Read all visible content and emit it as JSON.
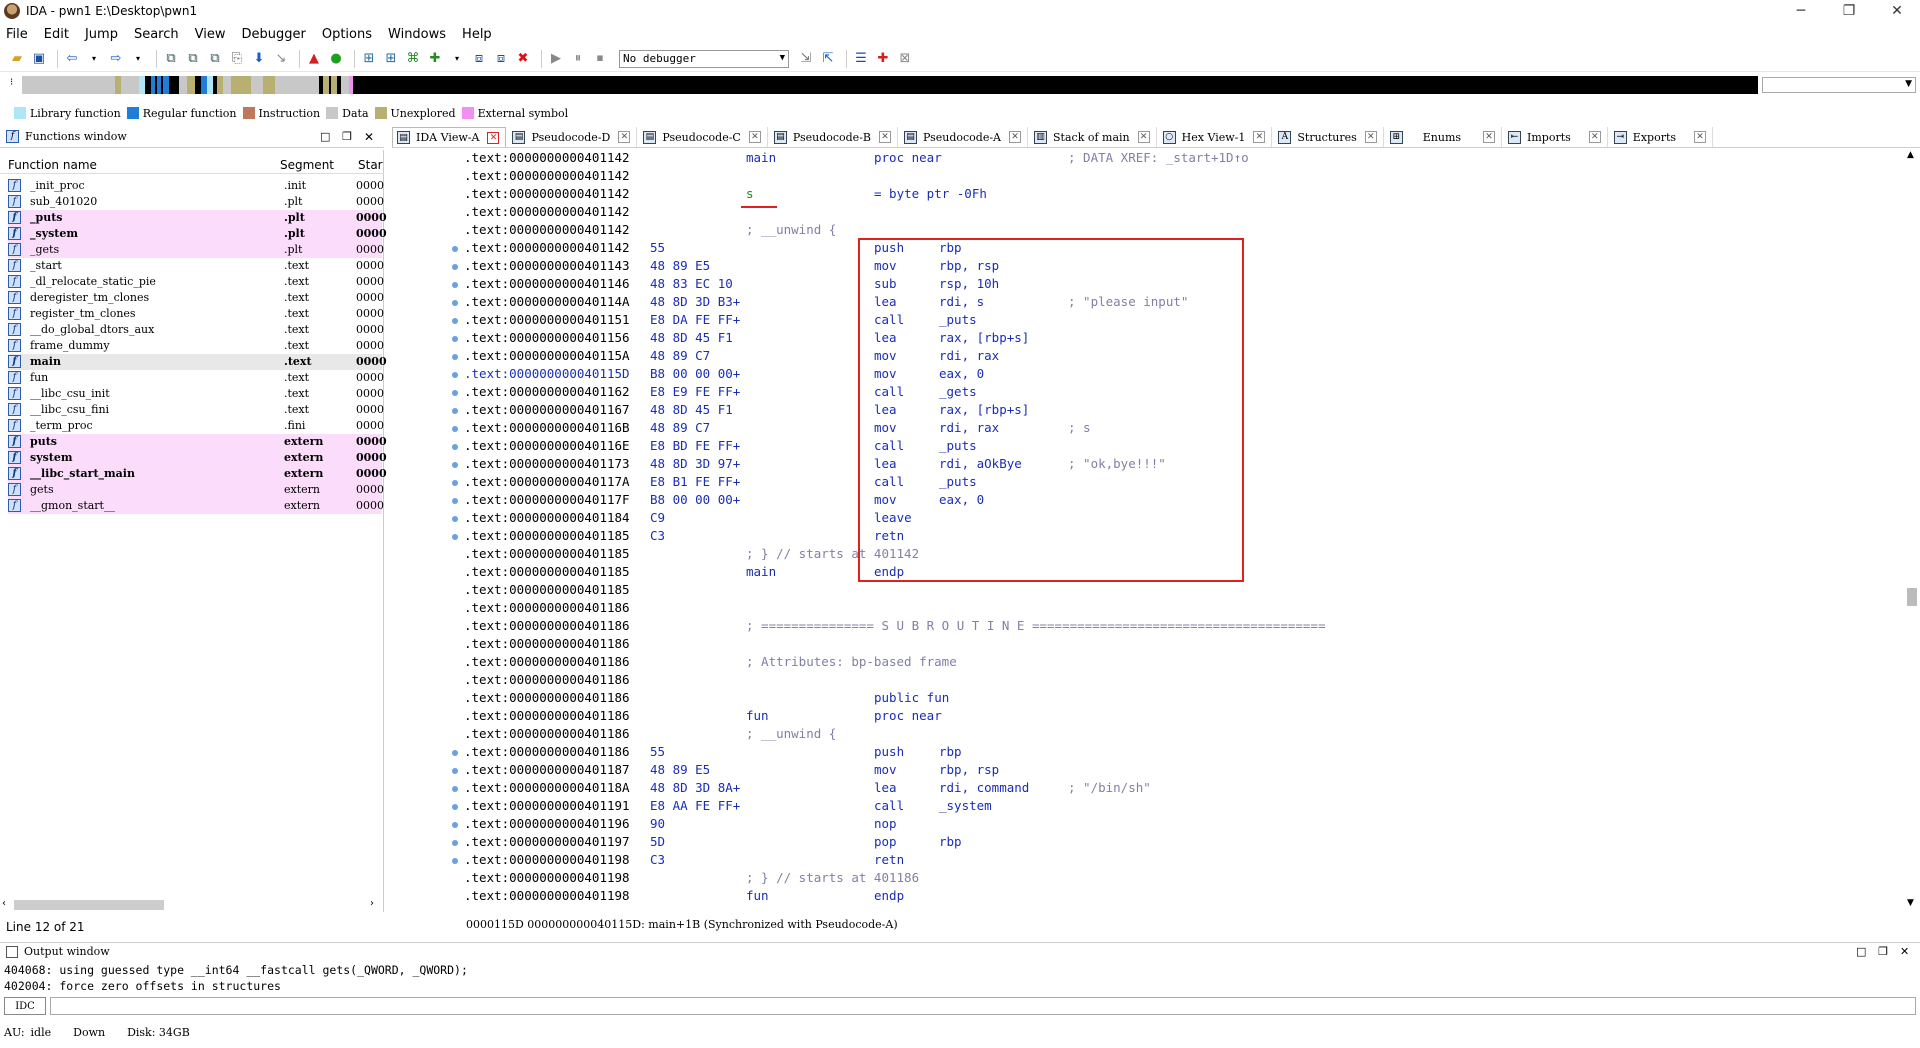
{
  "window": {
    "title": "IDA - pwn1 E:\\Desktop\\pwn1",
    "minimize": "─",
    "maximize": "❐",
    "close": "✕"
  },
  "menu": [
    "File",
    "Edit",
    "Jump",
    "Search",
    "View",
    "Debugger",
    "Options",
    "Windows",
    "Help"
  ],
  "toolbar": {
    "debugger_select": "No debugger"
  },
  "legend": [
    {
      "label": "Library function",
      "color": "#aee6f5"
    },
    {
      "label": "Regular function",
      "color": "#1f7fd8"
    },
    {
      "label": "Instruction",
      "color": "#c0785a"
    },
    {
      "label": "Data",
      "color": "#c8c8c8"
    },
    {
      "label": "Unexplored",
      "color": "#b8b070"
    },
    {
      "label": "External symbol",
      "color": "#f38ef3"
    }
  ],
  "functions_window": {
    "title": "Functions window",
    "columns": [
      "Function name",
      "Segment",
      "Star"
    ],
    "rows": [
      {
        "name": "_init_proc",
        "segment": ".init",
        "start": "0000"
      },
      {
        "name": "sub_401020",
        "segment": ".plt",
        "start": "0000"
      },
      {
        "name": "_puts",
        "segment": ".plt",
        "start": "0000"
      },
      {
        "name": "_system",
        "segment": ".plt",
        "start": "0000"
      },
      {
        "name": "_gets",
        "segment": ".plt",
        "start": "0000"
      },
      {
        "name": "_start",
        "segment": ".text",
        "start": "0000"
      },
      {
        "name": "_dl_relocate_static_pie",
        "segment": ".text",
        "start": "0000"
      },
      {
        "name": "deregister_tm_clones",
        "segment": ".text",
        "start": "0000"
      },
      {
        "name": "register_tm_clones",
        "segment": ".text",
        "start": "0000"
      },
      {
        "name": "__do_global_dtors_aux",
        "segment": ".text",
        "start": "0000"
      },
      {
        "name": "frame_dummy",
        "segment": ".text",
        "start": "0000"
      },
      {
        "name": "main",
        "segment": ".text",
        "start": "0000"
      },
      {
        "name": "fun",
        "segment": ".text",
        "start": "0000"
      },
      {
        "name": "__libc_csu_init",
        "segment": ".text",
        "start": "0000"
      },
      {
        "name": "__libc_csu_fini",
        "segment": ".text",
        "start": "0000"
      },
      {
        "name": "_term_proc",
        "segment": ".fini",
        "start": "0000"
      },
      {
        "name": "puts",
        "segment": "extern",
        "start": "0000"
      },
      {
        "name": "system",
        "segment": "extern",
        "start": "0000"
      },
      {
        "name": "__libc_start_main",
        "segment": "extern",
        "start": "0000"
      },
      {
        "name": "gets",
        "segment": "extern",
        "start": "0000"
      },
      {
        "name": "__gmon_start__",
        "segment": "extern",
        "start": "0000"
      }
    ],
    "status": "Line 12 of 21"
  },
  "tabs": [
    {
      "label": "IDA View-A",
      "icon": "ida-view-icon"
    },
    {
      "label": "Pseudocode-D",
      "icon": "pseudocode-icon"
    },
    {
      "label": "Pseudocode-C",
      "icon": "pseudocode-icon"
    },
    {
      "label": "Pseudocode-B",
      "icon": "pseudocode-icon"
    },
    {
      "label": "Pseudocode-A",
      "icon": "pseudocode-icon"
    },
    {
      "label": "Stack of main",
      "icon": "stack-icon"
    },
    {
      "label": "Hex View-1",
      "icon": "hex-icon"
    },
    {
      "label": "Structures",
      "icon": "structures-icon"
    },
    {
      "label": "Enums",
      "icon": "enums-icon"
    },
    {
      "label": "Imports",
      "icon": "imports-icon"
    },
    {
      "label": "Exports",
      "icon": "exports-icon"
    }
  ],
  "code_lines": [
    {
      "a": ".text:0000000000401142",
      "b": "",
      "l": "main",
      "m": "proc near",
      "o": "",
      "c": "; DATA XREF: _start+1D↑o"
    },
    {
      "a": ".text:0000000000401142",
      "b": "",
      "l": "",
      "m": "",
      "o": "",
      "c": ""
    },
    {
      "a": ".text:0000000000401142",
      "b": "",
      "l": "s",
      "m": "= byte ptr -0Fh",
      "o": "",
      "c": ""
    },
    {
      "a": ".text:0000000000401142",
      "b": "",
      "l": "",
      "m": "",
      "o": "",
      "c": ""
    },
    {
      "a": ".text:0000000000401142",
      "b": "",
      "l": "; __unwind {",
      "m": "",
      "o": "",
      "c": ""
    },
    {
      "a": ".text:0000000000401142",
      "b": "55",
      "l": "",
      "m": "push",
      "o": "rbp",
      "c": "",
      "dot": true
    },
    {
      "a": ".text:0000000000401143",
      "b": "48 89 E5",
      "l": "",
      "m": "mov",
      "o": "rbp, rsp",
      "c": "",
      "dot": true
    },
    {
      "a": ".text:0000000000401146",
      "b": "48 83 EC 10",
      "l": "",
      "m": "sub",
      "o": "rsp, 10h",
      "c": "",
      "dot": true
    },
    {
      "a": ".text:000000000040114A",
      "b": "48 8D 3D B3+",
      "l": "",
      "m": "lea",
      "o": "rdi, s",
      "c": "; \"please input\"",
      "dot": true
    },
    {
      "a": ".text:0000000000401151",
      "b": "E8 DA FE FF+",
      "l": "",
      "m": "call",
      "o": "_puts",
      "c": "",
      "dot": true
    },
    {
      "a": ".text:0000000000401156",
      "b": "48 8D 45 F1",
      "l": "",
      "m": "lea",
      "o": "rax, [rbp+s]",
      "c": "",
      "dot": true
    },
    {
      "a": ".text:000000000040115A",
      "b": "48 89 C7",
      "l": "",
      "m": "mov",
      "o": "rdi, rax",
      "c": "",
      "dot": true
    },
    {
      "a": ".text:000000000040115D",
      "b": "B8 00 00 00+",
      "l": "",
      "m": "mov",
      "o": "eax, 0",
      "c": "",
      "dot": true,
      "hl": true
    },
    {
      "a": ".text:0000000000401162",
      "b": "E8 E9 FE FF+",
      "l": "",
      "m": "call",
      "o": "_gets",
      "c": "",
      "dot": true
    },
    {
      "a": ".text:0000000000401167",
      "b": "48 8D 45 F1",
      "l": "",
      "m": "lea",
      "o": "rax, [rbp+s]",
      "c": "",
      "dot": true
    },
    {
      "a": ".text:000000000040116B",
      "b": "48 89 C7",
      "l": "",
      "m": "mov",
      "o": "rdi, rax",
      "c": "; s",
      "dot": true
    },
    {
      "a": ".text:000000000040116E",
      "b": "E8 BD FE FF+",
      "l": "",
      "m": "call",
      "o": "_puts",
      "c": "",
      "dot": true
    },
    {
      "a": ".text:0000000000401173",
      "b": "48 8D 3D 97+",
      "l": "",
      "m": "lea",
      "o": "rdi, aOkBye",
      "c": "; \"ok,bye!!!\"",
      "dot": true
    },
    {
      "a": ".text:000000000040117A",
      "b": "E8 B1 FE FF+",
      "l": "",
      "m": "call",
      "o": "_puts",
      "c": "",
      "dot": true
    },
    {
      "a": ".text:000000000040117F",
      "b": "B8 00 00 00+",
      "l": "",
      "m": "mov",
      "o": "eax, 0",
      "c": "",
      "dot": true
    },
    {
      "a": ".text:0000000000401184",
      "b": "C9",
      "l": "",
      "m": "leave",
      "o": "",
      "c": "",
      "dot": true
    },
    {
      "a": ".text:0000000000401185",
      "b": "C3",
      "l": "",
      "m": "retn",
      "o": "",
      "c": "",
      "dot": true
    },
    {
      "a": ".text:0000000000401185",
      "b": "",
      "l": "; } // starts at 401142",
      "m": "",
      "o": "",
      "c": ""
    },
    {
      "a": ".text:0000000000401185",
      "b": "",
      "l": "main",
      "m": "endp",
      "o": "",
      "c": ""
    },
    {
      "a": ".text:0000000000401185",
      "b": "",
      "l": "",
      "m": "",
      "o": "",
      "c": ""
    },
    {
      "a": ".text:0000000000401186",
      "b": "",
      "l": "",
      "m": "",
      "o": "",
      "c": ""
    },
    {
      "a": ".text:0000000000401186",
      "b": "",
      "l": "; =============== S U B R O U T I N E =======================================",
      "m": "",
      "o": "",
      "c": ""
    },
    {
      "a": ".text:0000000000401186",
      "b": "",
      "l": "",
      "m": "",
      "o": "",
      "c": ""
    },
    {
      "a": ".text:0000000000401186",
      "b": "",
      "l": "; Attributes: bp-based frame",
      "m": "",
      "o": "",
      "c": ""
    },
    {
      "a": ".text:0000000000401186",
      "b": "",
      "l": "",
      "m": "",
      "o": "",
      "c": ""
    },
    {
      "a": ".text:0000000000401186",
      "b": "",
      "l": "",
      "m": "public fun",
      "o": "",
      "c": ""
    },
    {
      "a": ".text:0000000000401186",
      "b": "",
      "l": "fun",
      "m": "proc near",
      "o": "",
      "c": ""
    },
    {
      "a": ".text:0000000000401186",
      "b": "",
      "l": "; __unwind {",
      "m": "",
      "o": "",
      "c": ""
    },
    {
      "a": ".text:0000000000401186",
      "b": "55",
      "l": "",
      "m": "push",
      "o": "rbp",
      "c": "",
      "dot": true
    },
    {
      "a": ".text:0000000000401187",
      "b": "48 89 E5",
      "l": "",
      "m": "mov",
      "o": "rbp, rsp",
      "c": "",
      "dot": true
    },
    {
      "a": ".text:000000000040118A",
      "b": "48 8D 3D 8A+",
      "l": "",
      "m": "lea",
      "o": "rdi, command",
      "c": "; \"/bin/sh\"",
      "dot": true
    },
    {
      "a": ".text:0000000000401191",
      "b": "E8 AA FE FF+",
      "l": "",
      "m": "call",
      "o": "_system",
      "c": "",
      "dot": true
    },
    {
      "a": ".text:0000000000401196",
      "b": "90",
      "l": "",
      "m": "nop",
      "o": "",
      "c": "",
      "dot": true
    },
    {
      "a": ".text:0000000000401197",
      "b": "5D",
      "l": "",
      "m": "pop",
      "o": "rbp",
      "c": "",
      "dot": true
    },
    {
      "a": ".text:0000000000401198",
      "b": "C3",
      "l": "",
      "m": "retn",
      "o": "",
      "c": "",
      "dot": true
    },
    {
      "a": ".text:0000000000401198",
      "b": "",
      "l": "; } // starts at 401186",
      "m": "",
      "o": "",
      "c": ""
    },
    {
      "a": ".text:0000000000401198",
      "b": "",
      "l": "fun",
      "m": "endp",
      "o": "",
      "c": ""
    }
  ],
  "code_status": "0000115D 000000000040115D: main+1B (Synchronized with Pseudocode-A)",
  "output": {
    "title": "Output window",
    "lines": [
      "404068: using guessed type __int64 __fastcall gets(_QWORD, _QWORD);",
      "402004: force zero offsets in structures"
    ],
    "prompt": "IDC"
  },
  "statusbar": {
    "au": "AU:",
    "state": "idle",
    "dir": "Down",
    "disk": "Disk: 34GB"
  },
  "colors": {
    "highlight_box": "#e02020",
    "code_blue": "#1a2db8",
    "comment": "#8080a8",
    "extern_row": "#fbdcfb"
  }
}
